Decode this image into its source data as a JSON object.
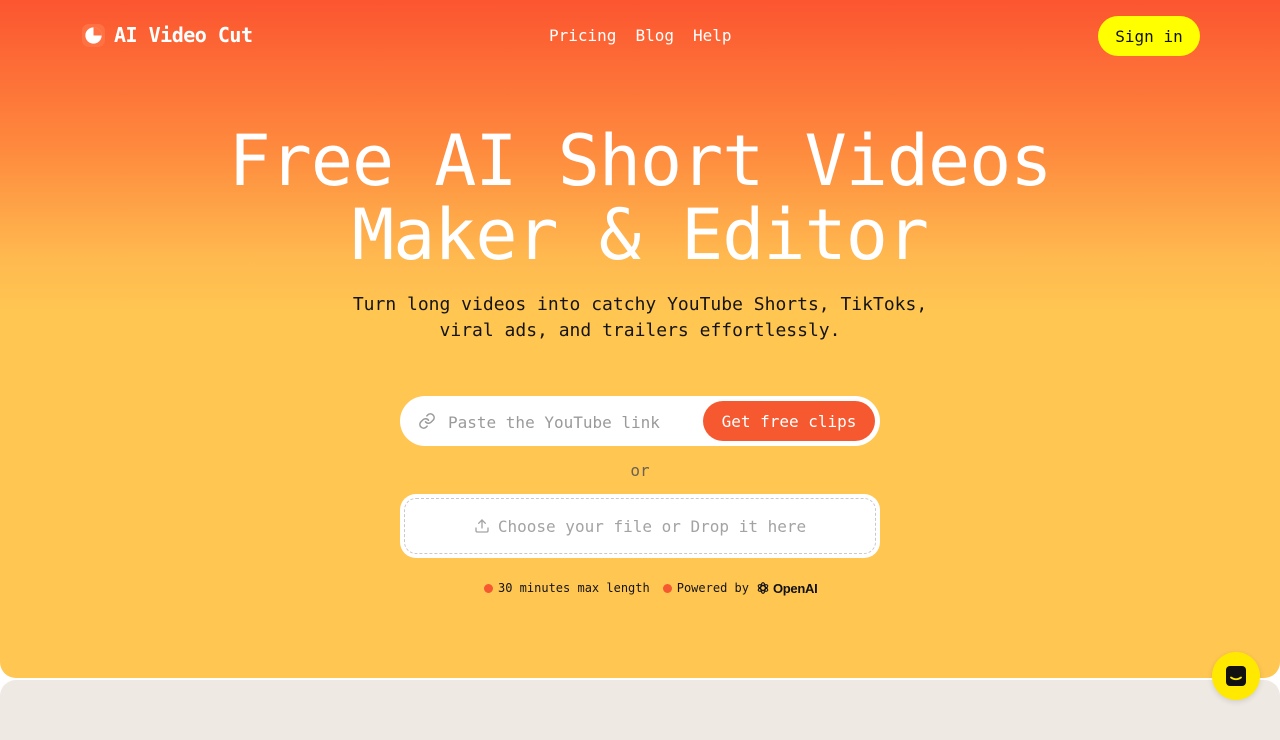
{
  "header": {
    "logo_text": "AI Video Cut",
    "nav": [
      "Pricing",
      "Blog",
      "Help"
    ],
    "signin_label": "Sign in"
  },
  "hero": {
    "headline_line1": "Free AI Short Videos",
    "headline_line2": "Maker & Editor",
    "subtitle_line1": "Turn long videos into catchy YouTube Shorts, TikToks,",
    "subtitle_line2": "viral ads, and trailers effortlessly."
  },
  "url_form": {
    "placeholder": "Paste the YouTube link",
    "value": "",
    "button_label": "Get free clips"
  },
  "divider_text": "or",
  "upload": {
    "label": "Choose your file or Drop it here"
  },
  "features": {
    "max_length": "30 minutes max length",
    "powered_by": "Powered by",
    "provider": "OpenAI"
  },
  "colors": {
    "accent": "#f6582f",
    "signin_bg": "#ffff00",
    "chat_bg": "#ffe900",
    "gradient_top": "#fc5530",
    "gradient_bottom": "#ffc652"
  },
  "icons": {
    "logo": "logo-icon",
    "link": "link-icon",
    "upload": "upload-icon",
    "openai": "openai-icon",
    "chat": "chat-icon"
  }
}
